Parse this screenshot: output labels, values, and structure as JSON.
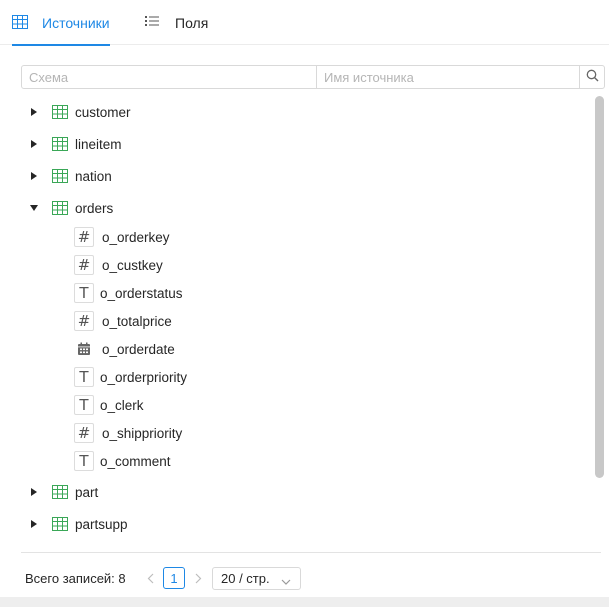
{
  "tabs": [
    {
      "label": "Источники",
      "icon": "table-icon",
      "active": true
    },
    {
      "label": "Поля",
      "icon": "list-icon",
      "active": false
    }
  ],
  "search": {
    "schema_placeholder": "Схема",
    "name_placeholder": "Имя источника",
    "button_icon": "search-icon"
  },
  "tree": {
    "sources": [
      {
        "name": "customer",
        "expanded": false
      },
      {
        "name": "lineitem",
        "expanded": false
      },
      {
        "name": "nation",
        "expanded": false
      },
      {
        "name": "orders",
        "expanded": true,
        "fields": [
          {
            "name": "o_orderkey",
            "type": "number"
          },
          {
            "name": "o_custkey",
            "type": "number"
          },
          {
            "name": "o_orderstatus",
            "type": "text"
          },
          {
            "name": "o_totalprice",
            "type": "number"
          },
          {
            "name": "o_orderdate",
            "type": "date"
          },
          {
            "name": "o_orderpriority",
            "type": "text"
          },
          {
            "name": "o_clerk",
            "type": "text"
          },
          {
            "name": "o_shippriority",
            "type": "number"
          },
          {
            "name": "o_comment",
            "type": "text"
          }
        ]
      },
      {
        "name": "part",
        "expanded": false
      },
      {
        "name": "partsupp",
        "expanded": false
      }
    ]
  },
  "type_glyphs": {
    "number": "#",
    "text": "T"
  },
  "pagination": {
    "total_label": "Всего записей: 8",
    "current_page": "1",
    "page_size": "20 / стр."
  },
  "colors": {
    "accent": "#1e88e5",
    "table_icon": "#3aa757",
    "text": "#262626"
  }
}
